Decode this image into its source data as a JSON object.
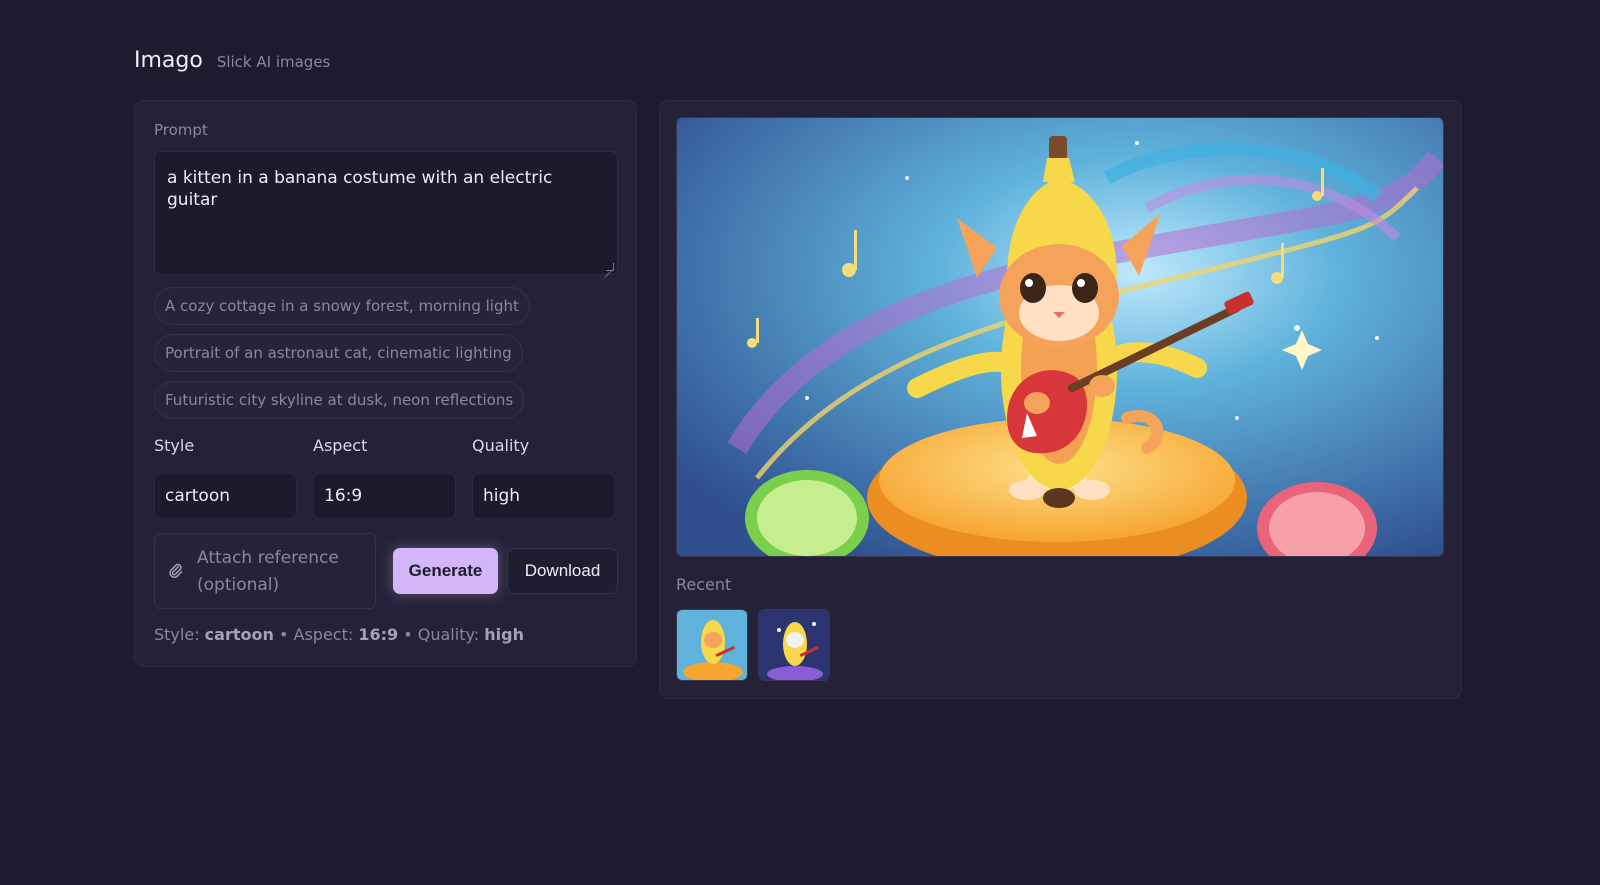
{
  "header": {
    "title": "Imago",
    "subtitle": "Slick AI images"
  },
  "form": {
    "prompt_label": "Prompt",
    "prompt_value": "a kitten in a banana costume with an electric guitar",
    "suggestions": [
      "A cozy cottage in a snowy forest, morning light",
      "Portrait of an astronaut cat, cinematic lighting",
      "Futuristic city skyline at dusk, neon reflections"
    ],
    "style_label": "Style",
    "style_value": "cartoon",
    "aspect_label": "Aspect",
    "aspect_value": "16:9",
    "quality_label": "Quality",
    "quality_value": "high",
    "attach_label": "Attach reference (optional)",
    "generate_label": "Generate",
    "download_label": "Download",
    "summary": {
      "style_key": "Style:",
      "style_val": "cartoon",
      "aspect_key": "Aspect:",
      "aspect_val": "16:9",
      "quality_key": "Quality:",
      "quality_val": "high",
      "separator": "•"
    }
  },
  "preview": {
    "recent_label": "Recent"
  },
  "icons": {
    "attach": "paperclip-icon",
    "resize": "resize-grip-icon"
  },
  "colors": {
    "background": "#1d1b2e",
    "panel": "#252238",
    "accent": "#d2b6f7"
  }
}
